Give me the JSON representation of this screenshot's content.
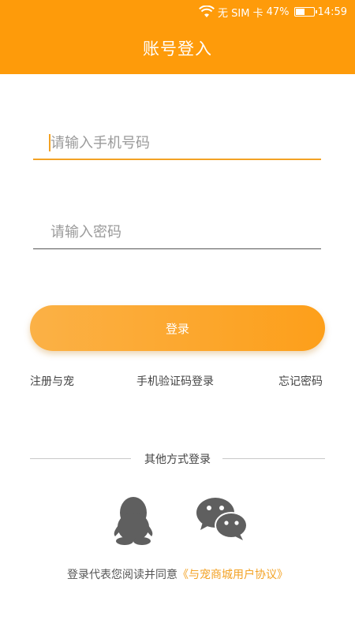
{
  "status_bar": {
    "sim": "无 SIM 卡",
    "battery": "47%",
    "time": "14:59"
  },
  "header": {
    "title": "账号登入"
  },
  "form": {
    "phone_placeholder": "请输入手机号码",
    "password_placeholder": "请输入密码",
    "login_label": "登录"
  },
  "links": {
    "register": "注册与宠",
    "sms_login": "手机验证码登录",
    "forgot": "忘记密码"
  },
  "other_login": {
    "label": "其他方式登录",
    "icons": [
      "qq-icon",
      "wechat-icon"
    ]
  },
  "agreement": {
    "prefix": "登录代表您阅读并同意",
    "link": "《与宠商城用户协议》"
  },
  "colors": {
    "accent": "#fe9b0a",
    "link": "#f3a224",
    "icon_gray": "#5f5f5f"
  }
}
